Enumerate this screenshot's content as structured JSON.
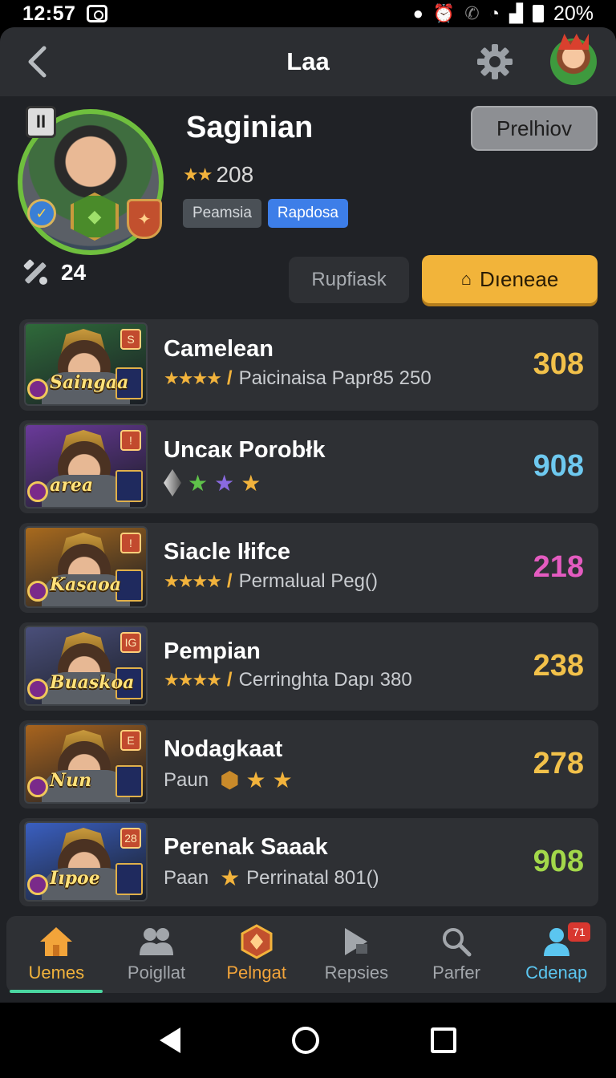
{
  "status": {
    "time": "12:57",
    "battery": "20%"
  },
  "header": {
    "title": "Laa"
  },
  "profile": {
    "name": "Saginian",
    "rating": "208",
    "stars": "★★",
    "tags": [
      "Peamsia",
      "Rapdosa"
    ],
    "preview_label": "Prelhiov",
    "count": "24",
    "secondary_button": "Rupfiask",
    "primary_button": "Dıeneae"
  },
  "rows": [
    {
      "name": "Camelean",
      "stars": "★★★★",
      "subtitle": "Paicinaisa Papr85 250",
      "score": "308",
      "score_color": "#f2c14a",
      "thumb_label": "Saingaa",
      "thumb_bg": "#2f6a3a",
      "thumb_num": "S"
    },
    {
      "name": "Uncaк Porobłk",
      "stars": "",
      "subtitle": "",
      "score": "908",
      "score_color": "#6ec9f0",
      "thumb_label": "areа",
      "thumb_bg": "#6a3a9a",
      "thumb_num": "!"
    },
    {
      "name": "Siacle Iłifce",
      "stars": "★★★★",
      "subtitle": "Permalual Peg()",
      "score": "218",
      "score_color": "#e45bc0",
      "thumb_label": "Kasaoa",
      "thumb_bg": "#a86a1e",
      "thumb_num": "!"
    },
    {
      "name": "Pempian",
      "stars": "★★★★",
      "subtitle": "Cerringhta Dapı 380",
      "score": "238",
      "score_color": "#f2c14a",
      "thumb_label": "Buaskoa",
      "thumb_bg": "#4a4f7a",
      "thumb_num": "IG"
    },
    {
      "name": "Nodagkaat",
      "stars": "",
      "subtitle": "Paun",
      "score": "278",
      "score_color": "#f2c14a",
      "thumb_label": "Nun",
      "thumb_bg": "#a8641e",
      "thumb_num": "E"
    },
    {
      "name": "Perenak Saaak",
      "stars": "★",
      "subtitle": "Perrinatal 801()",
      "score": "908",
      "score_color": "#a3d84a",
      "thumb_label": "Iıpoe",
      "thumb_bg": "#3a5fc0",
      "thumb_num": "28",
      "sub_prefix": "Paan"
    }
  ],
  "nav": [
    {
      "label": "Uemes",
      "icon": "home-icon",
      "active": true
    },
    {
      "label": "Poigllat",
      "icon": "users-icon"
    },
    {
      "label": "Pelngat",
      "icon": "emblem-icon"
    },
    {
      "label": "Repsies",
      "icon": "play-icon"
    },
    {
      "label": "Parfer",
      "icon": "search-icon"
    },
    {
      "label": "Cdenap",
      "icon": "person-icon",
      "badge": "71"
    }
  ],
  "colors": {
    "accent": "#f2b43a",
    "tag_blue": "#3d7ee8",
    "nav_active": "#f2b33c",
    "nav_profile": "#5bc6f0"
  }
}
